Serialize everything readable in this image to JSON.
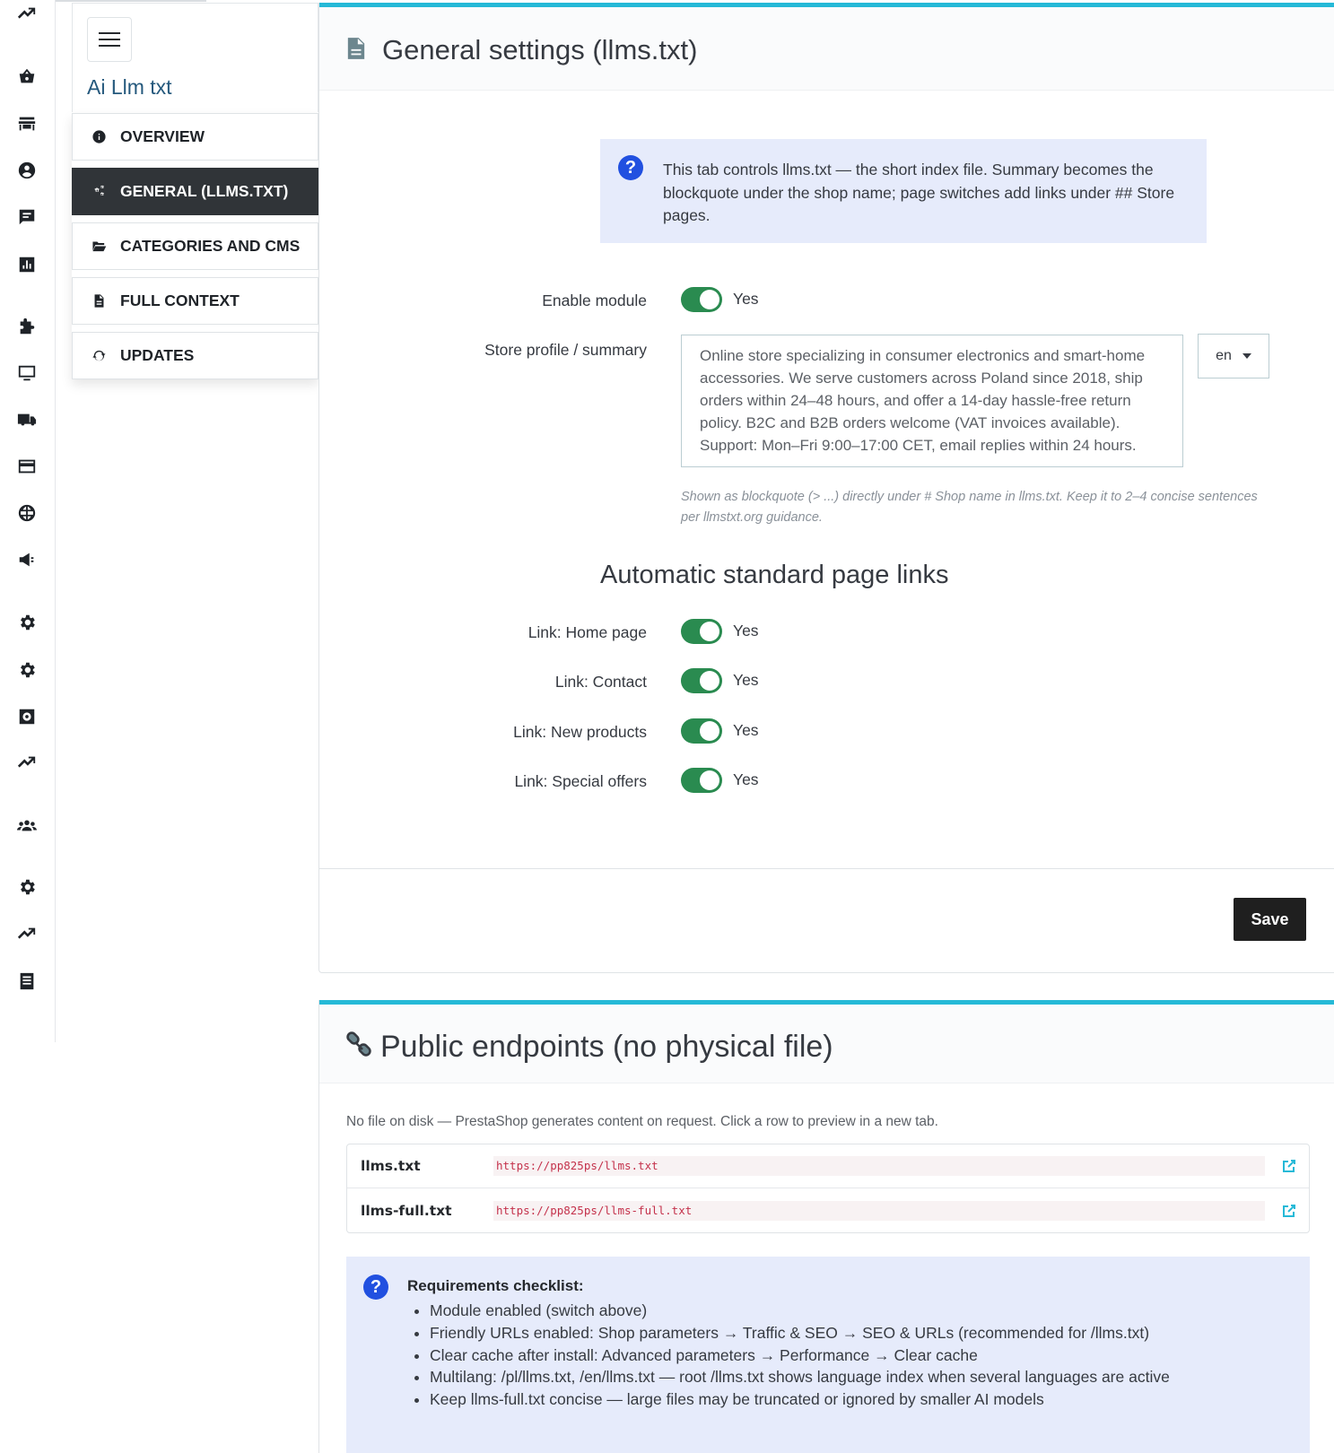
{
  "module": {
    "title": "Ai Llm txt",
    "nav": [
      {
        "label": "OVERVIEW",
        "icon": "info-circle-icon"
      },
      {
        "label": "GENERAL (LLMS.TXT)",
        "icon": "gears-icon",
        "active": true
      },
      {
        "label": "CATEGORIES AND CMS",
        "icon": "folder-open-icon"
      },
      {
        "label": "FULL CONTEXT",
        "icon": "file-text-icon"
      },
      {
        "label": "UPDATES",
        "icon": "refresh-icon"
      }
    ]
  },
  "general": {
    "title": "General settings (llms.txt)",
    "info": "This tab controls llms.txt — the short index file. Summary becomes the blockquote under the shop name; page switches add links under ## Store pages.",
    "enable_label": "Enable module",
    "enable_value": "Yes",
    "summary_label": "Store profile / summary",
    "summary_text": "Online store specializing in consumer electronics and smart-home accessories. We serve customers across Poland since 2018, ship orders within 24–48 hours, and offer a 14-day hassle-free return policy. B2C and B2B orders welcome (VAT invoices available). Support: Mon–Fri 9:00–17:00 CET, email replies within 24 hours.",
    "lang": "en",
    "help": "Shown as blockquote (> ...) directly under # Shop name in llms.txt. Keep it to 2–4 concise sentences per llmstxt.org guidance.",
    "links_heading": "Automatic standard page links",
    "links": [
      {
        "label": "Link: Home page",
        "value": "Yes"
      },
      {
        "label": "Link: Contact",
        "value": "Yes"
      },
      {
        "label": "Link: New products",
        "value": "Yes"
      },
      {
        "label": "Link: Special offers",
        "value": "Yes"
      }
    ],
    "save_label": "Save"
  },
  "endpoints": {
    "title": "Public endpoints (no physical file)",
    "desc": "No file on disk — PrestaShop generates content on request. Click a row to preview in a new tab.",
    "rows": [
      {
        "name": "llms.txt",
        "url": "https://pp825ps/llms.txt"
      },
      {
        "name": "llms-full.txt",
        "url": "https://pp825ps/llms-full.txt"
      }
    ],
    "checklist_title": "Requirements checklist:",
    "checklist": [
      "Module enabled (switch above)",
      "Friendly URLs enabled: Shop parameters → Traffic & SEO → SEO & URLs (recommended for /llms.txt)",
      "Clear cache after install: Advanced parameters → Performance → Clear cache",
      "Multilang: /pl/llms.txt, /en/llms.txt — root /llms.txt shows language index when several languages are active",
      "Keep llms-full.txt concise — large files may be truncated or ignored by smaller AI models"
    ]
  },
  "colors": {
    "accent": "#25b9d7",
    "toggle_on": "#2a8b50",
    "info_bg": "#e6ebfb",
    "active_nav": "#303438"
  },
  "rail_icons": [
    "trend-icon",
    "basket-icon",
    "store-icon",
    "user-icon",
    "chat-icon",
    "stats-icon",
    "puzzle-icon",
    "monitor-icon",
    "truck-icon",
    "card-icon",
    "globe-icon",
    "megaphone-icon",
    "gear-icon",
    "gear-icon",
    "gear-box-icon",
    "trend-icon",
    "team-icon",
    "gear-icon",
    "trend-icon",
    "list-icon"
  ]
}
